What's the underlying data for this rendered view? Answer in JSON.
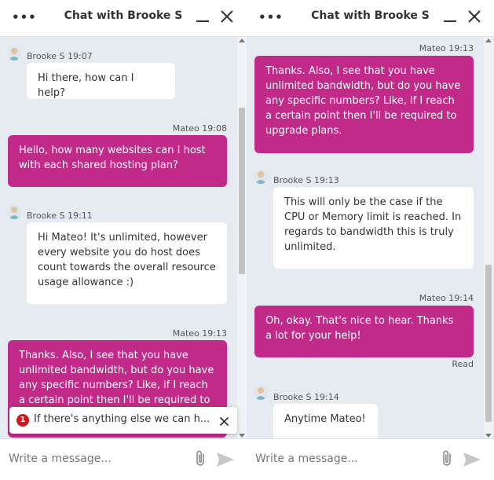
{
  "left": {
    "header": {
      "title": "Chat with Brooke S"
    },
    "messages": [
      {
        "meta": "Brooke S 19:07",
        "text": "Hi there, how can I help?"
      },
      {
        "meta": "Mateo 19:08",
        "text": "Hello, how many websites can I host with each shared hosting plan?"
      },
      {
        "meta": "Brooke S 19:11",
        "text": "Hi Mateo! It's unlimited, however every website you do host does count towards the overall resource usage allowance :)"
      },
      {
        "meta": "Mateo 19:13",
        "text": "Thanks. Also, I see that you have unlimited bandwidth, but do you have any specific numbers? Like, if I reach a certain point then I'll be required to upgrade plans."
      }
    ],
    "notification": {
      "badge": "1",
      "text": "If there's anything else we can h..."
    },
    "composer": {
      "placeholder": "Write a message..."
    },
    "scroll_position": 0.3
  },
  "right": {
    "header": {
      "title": "Chat with Brooke S"
    },
    "messages": [
      {
        "meta": "Mateo 19:13",
        "text": "Thanks. Also, I see that you have unlimited bandwidth, but do you have any specific numbers? Like, if I reach a certain point then I'll be required to upgrade plans."
      },
      {
        "meta": "Brooke S 19:13",
        "text": "This will only be the case if the CPU or Memory limit is reached. In regards to bandwidth this is truly unlimited."
      },
      {
        "meta": "Mateo 19:14",
        "text": "Oh, okay. That's nice to hear. Thanks a lot for your help!"
      },
      {
        "meta": "Brooke S 19:14",
        "text": "Anytime Mateo!"
      }
    ],
    "read_receipt": "Read",
    "composer": {
      "placeholder": "Write a message..."
    },
    "scroll_position": 0.95
  },
  "colors": {
    "agent_bubble": "#ffffff",
    "user_bubble": "#c12a89",
    "background": "#e6ebf1",
    "notification_badge": "#d0181b"
  },
  "icons": [
    "more-icon",
    "minimize-icon",
    "close-icon",
    "avatar",
    "paperclip-icon",
    "send-icon"
  ]
}
